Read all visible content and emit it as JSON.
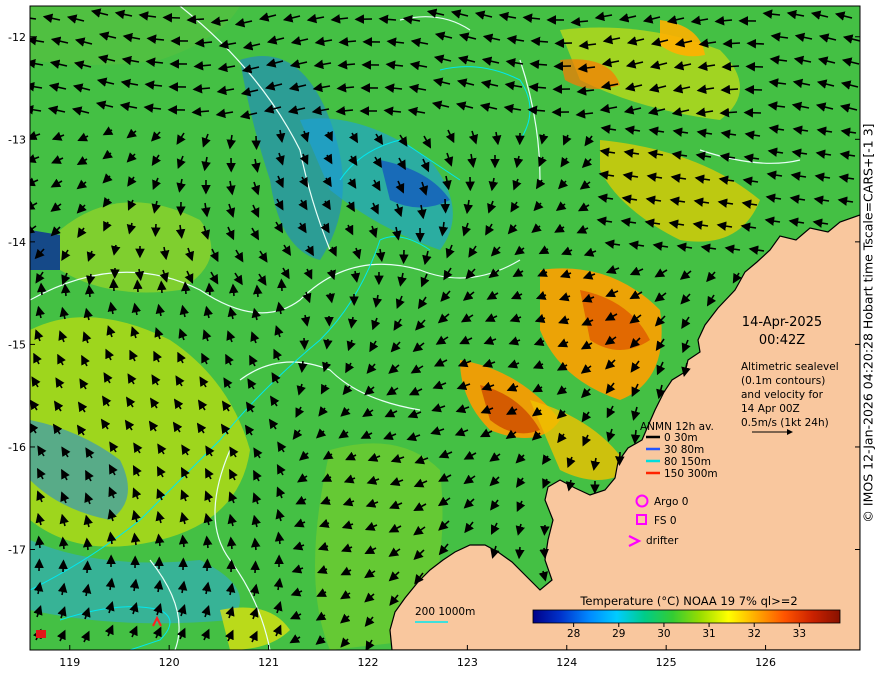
{
  "map": {
    "x_ticks": [
      "119",
      "120",
      "121",
      "122",
      "123",
      "124",
      "125",
      "126"
    ],
    "y_ticks": [
      "-12",
      "-13",
      "-14",
      "-15",
      "-16",
      "-17"
    ],
    "lon_range": [
      118.6,
      126.95
    ],
    "lat_range": [
      -17.98,
      -11.7
    ]
  },
  "annotation": {
    "date": "14-Apr-2025",
    "time": "00:42Z",
    "desc_lines": [
      "Altimetric sealevel",
      "(0.1m contours)",
      "and velocity for",
      "14 Apr 00Z",
      "0.5m/s (1kt 24h)"
    ]
  },
  "legend": {
    "title": "ANMN 12h av.",
    "items": [
      {
        "label": "0 30m",
        "color": "#000000"
      },
      {
        "label": "30 80m",
        "color": "#2255ff"
      },
      {
        "label": "80 150m",
        "color": "#00dddd"
      },
      {
        "label": "150 300m",
        "color": "#ff2200"
      }
    ],
    "markers": [
      {
        "label": "Argo 0",
        "icon": "circle-icon",
        "color": "#ff00ff"
      },
      {
        "label": "FS 0",
        "icon": "square-icon",
        "color": "#ff00ff"
      },
      {
        "label": "drifter",
        "icon": "chevron-icon",
        "color": "#ff00ff"
      }
    ]
  },
  "depth_label": "200  1000m",
  "colorbar": {
    "title": "Temperature (°C) NOAA 19 7% ql>=2",
    "ticks": [
      "28",
      "29",
      "30",
      "31",
      "32",
      "33"
    ],
    "range": [
      27.1,
      33.9
    ],
    "colors": [
      "#000088",
      "#0033cc",
      "#0088ff",
      "#00ccff",
      "#00cc88",
      "#33cc33",
      "#99dd00",
      "#ffff00",
      "#ffaa00",
      "#ff5500",
      "#cc2200",
      "#881100"
    ]
  },
  "side_text": "© IMOS 12-Jan-2026 04:20:28 Hobart time Tscale=CARS+[-1 3]"
}
